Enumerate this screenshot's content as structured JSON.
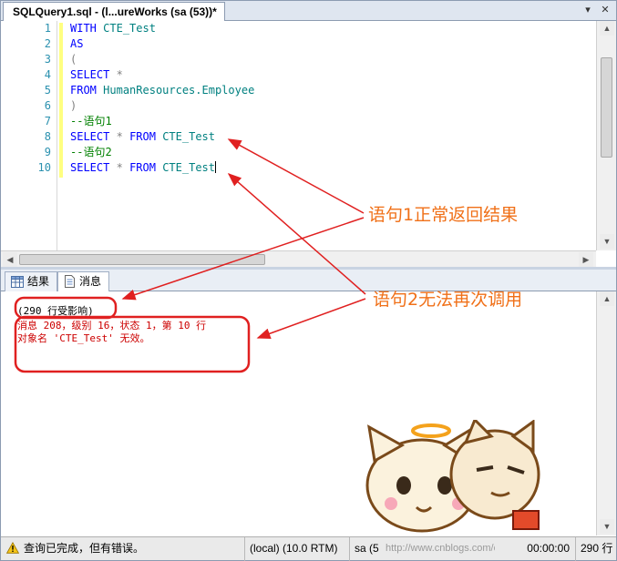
{
  "window": {
    "tab_title": "SQLQuery1.sql - (l...ureWorks (sa (53))*",
    "pin_glyph": "▾",
    "close_glyph": "✕"
  },
  "editor": {
    "line_numbers": [
      "1",
      "2",
      "3",
      "4",
      "5",
      "6",
      "7",
      "8",
      "9",
      "10"
    ],
    "lines": {
      "l1_kw": "WITH",
      "l1_id": "CTE_Test",
      "l2_kw": "AS",
      "l3_p": "(",
      "l4_kw": "SELECT",
      "l4_star": "*",
      "l5_kw": "FROM",
      "l5_id": "HumanResources.Employee",
      "l6_p": ")",
      "l7_cmt": "--语句1",
      "l8_kw1": "SELECT",
      "l8_star": "*",
      "l8_kw2": "FROM",
      "l8_id": "CTE_Test",
      "l9_cmt": "--语句2",
      "l10_kw1": "SELECT",
      "l10_star": "*",
      "l10_kw2": "FROM",
      "l10_id": "CTE_Test"
    },
    "colors": {
      "keyword": "#0000ff",
      "identifier": "#008080",
      "comment": "#008000",
      "line_number": "#2b91af"
    }
  },
  "results_tabs": [
    {
      "label": "结果",
      "icon": "grid-icon"
    },
    {
      "label": "消息",
      "icon": "message-doc-icon",
      "active": true
    }
  ],
  "messages": {
    "rows_affected": "(290 行受影响)",
    "error_line1": "消息 208，级别 16，状态 1，第 10 行",
    "error_line2": "对象名 'CTE_Test' 无效。",
    "error_color": "#cc0000"
  },
  "status": {
    "message": "查询已完成，但有错误。",
    "server": "(local) (10.0 RTM)",
    "user": "sa (5",
    "watermark": "http://www.cnblogs.com/careyson",
    "elapsed": "00:00:00",
    "rows": "290 行",
    "status_icon": "warning-triangle-icon"
  },
  "annotations": {
    "label1": "语句1正常返回结果",
    "label2": "语句2无法再次调用",
    "color": "#e02020",
    "text_color": "#f07018"
  }
}
